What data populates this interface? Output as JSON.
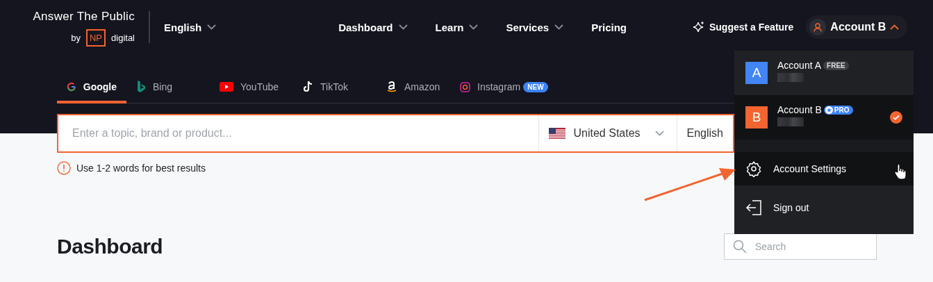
{
  "brand": {
    "name": "Answer The Public",
    "by": "by",
    "np": "NP",
    "digital": "digital"
  },
  "language_menu": {
    "label": "English"
  },
  "nav": [
    {
      "label": "Dashboard",
      "dropdown": true
    },
    {
      "label": "Learn",
      "dropdown": true
    },
    {
      "label": "Services",
      "dropdown": true
    },
    {
      "label": "Pricing",
      "dropdown": false
    }
  ],
  "suggest": {
    "label": "Suggest a Feature"
  },
  "account": {
    "label": "Account B",
    "expanded": true
  },
  "engines": [
    {
      "kind": "google",
      "label": "Google",
      "selected": true
    },
    {
      "kind": "bing",
      "label": "Bing",
      "selected": false
    },
    {
      "kind": "youtube",
      "label": "YouTube",
      "selected": false
    },
    {
      "kind": "tiktok",
      "label": "TikTok",
      "selected": false
    },
    {
      "kind": "amazon",
      "label": "Amazon",
      "selected": false
    },
    {
      "kind": "instagram",
      "label": "Instagram",
      "selected": false,
      "badge": "NEW"
    }
  ],
  "search": {
    "placeholder": "Enter a topic, brand or product...",
    "country": "United States",
    "language": "English"
  },
  "hint": "Use 1-2 words for best results",
  "menu": {
    "accounts": [
      {
        "initial": "A",
        "name": "Account A",
        "plan": "FREE",
        "kind": "plain",
        "color": "#4285f4",
        "selected": false
      },
      {
        "initial": "B",
        "name": "Account B",
        "plan": "PRO",
        "kind": "star",
        "color": "#f26430",
        "selected": true
      }
    ],
    "items": [
      {
        "kind": "settings",
        "label": "Account Settings",
        "hovered": true
      },
      {
        "kind": "signout",
        "label": "Sign out",
        "hovered": false
      }
    ]
  },
  "dashboard": {
    "title": "Dashboard",
    "search_placeholder": "Search"
  }
}
